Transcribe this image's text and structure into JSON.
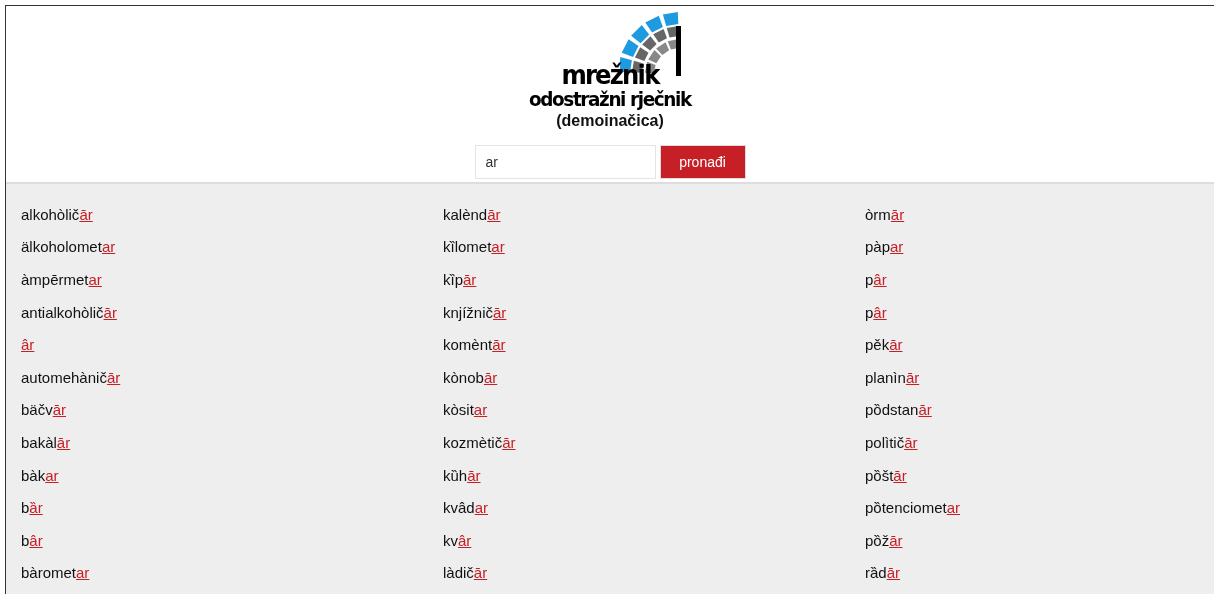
{
  "logo": {
    "title": "mrežnik",
    "subtitle": "odostražni rječnik",
    "edition": "(demoinačica)"
  },
  "search": {
    "value": "ar",
    "button": "pronađi"
  },
  "results": [
    {
      "stem": "alkohòlič",
      "match": "ār"
    },
    {
      "stem": "älkoholomet",
      "match": "ar"
    },
    {
      "stem": "àmpērmet",
      "match": "ar"
    },
    {
      "stem": "antialkohòlič",
      "match": "ār"
    },
    {
      "match": "âr"
    },
    {
      "stem": "automehànič",
      "match": "ār"
    },
    {
      "stem": "bäčv",
      "match": "ār"
    },
    {
      "stem": "bakàl",
      "match": "ār"
    },
    {
      "stem": "bàk",
      "match": "ar"
    },
    {
      "stem": "b",
      "match": "ȁr"
    },
    {
      "stem": "b",
      "match": "âr"
    },
    {
      "stem": "bàromet",
      "match": "ar"
    },
    {
      "stem": "kalènd",
      "match": "ār"
    },
    {
      "stem": "kȉlomet",
      "match": "ar"
    },
    {
      "stem": "kȉp",
      "match": "ār"
    },
    {
      "stem": "knjížnič",
      "match": "ār"
    },
    {
      "stem": "komènt",
      "match": "ār"
    },
    {
      "stem": "kònob",
      "match": "ār"
    },
    {
      "stem": "kòsit",
      "match": "ar"
    },
    {
      "stem": "kozmètič",
      "match": "ār"
    },
    {
      "stem": "kȕh",
      "match": "ār"
    },
    {
      "stem": "kvâd",
      "match": "ar"
    },
    {
      "stem": "kv",
      "match": "âr"
    },
    {
      "stem": "làdič",
      "match": "ār"
    },
    {
      "stem": "òrm",
      "match": "ār"
    },
    {
      "stem": "pàp",
      "match": "ar"
    },
    {
      "stem": "p",
      "match": "âr"
    },
    {
      "stem": "p",
      "match": "âr"
    },
    {
      "stem": "pěk",
      "match": "ār"
    },
    {
      "stem": "planìn",
      "match": "ār"
    },
    {
      "stem": "pȍdstan",
      "match": "ār"
    },
    {
      "stem": "polìtič",
      "match": "ār"
    },
    {
      "stem": "pȍšt",
      "match": "ār"
    },
    {
      "stem": "pȍtenciomet",
      "match": "ar"
    },
    {
      "stem": "pȍž",
      "match": "ār"
    },
    {
      "stem": "rȁd",
      "match": "ār"
    }
  ]
}
